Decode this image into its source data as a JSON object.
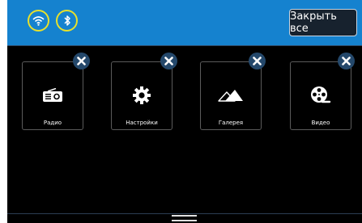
{
  "status": {
    "wifi_icon": "wifi-icon",
    "bluetooth_icon": "bluetooth-icon",
    "ring_color": "#e8e12b"
  },
  "header": {
    "close_all_label": "Закрыть все",
    "background": "#1582cf"
  },
  "apps": [
    {
      "label": "Радио",
      "icon": "radio-icon"
    },
    {
      "label": "Настройки",
      "icon": "gear-icon"
    },
    {
      "label": "Галерея",
      "icon": "mountains-icon"
    },
    {
      "label": "Видео",
      "icon": "film-reel-icon"
    }
  ]
}
